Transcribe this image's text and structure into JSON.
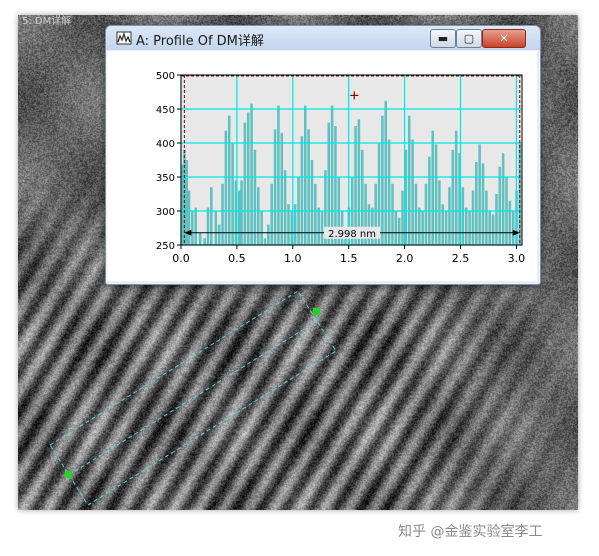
{
  "window": {
    "title": "A: Profile Of DM详解",
    "minimize_glyph": "▬",
    "maximize_glyph": "▢",
    "close_glyph": "✕",
    "app_icon": "profile-tool-icon",
    "behind_title": "5: DM详解"
  },
  "colors": {
    "plot_background": "#e8e8e8",
    "grid": "#00e6e6",
    "bars": "#5fc1c0",
    "marker": "#8b0000",
    "selection_outline": "#58d6e0",
    "handle": "#21d421"
  },
  "chart_data": {
    "type": "bar",
    "x_range": [
      0.0,
      3.05
    ],
    "ylim": [
      250,
      500
    ],
    "x_ticks": [
      "0.0",
      "0.5",
      "1.0",
      "1.5",
      "2.0",
      "2.5",
      "3.0"
    ],
    "y_ticks": [
      "250",
      "300",
      "350",
      "400",
      "450",
      "500"
    ],
    "grid": true,
    "measurement_label": "2.998 nm",
    "measurement_range": [
      0.03,
      3.03
    ],
    "crosshair": [
      1.55,
      470
    ],
    "profile": [
      [
        0.0,
        368
      ],
      [
        0.02,
        390
      ],
      [
        0.04,
        375
      ],
      [
        0.06,
        330
      ],
      [
        0.09,
        300
      ],
      [
        0.12,
        305
      ],
      [
        0.16,
        268
      ],
      [
        0.2,
        260
      ],
      [
        0.23,
        305
      ],
      [
        0.26,
        335
      ],
      [
        0.3,
        300
      ],
      [
        0.33,
        280
      ],
      [
        0.36,
        340
      ],
      [
        0.39,
        418
      ],
      [
        0.42,
        440
      ],
      [
        0.45,
        400
      ],
      [
        0.48,
        345
      ],
      [
        0.51,
        330
      ],
      [
        0.53,
        345
      ],
      [
        0.56,
        430
      ],
      [
        0.59,
        445
      ],
      [
        0.62,
        458
      ],
      [
        0.65,
        390
      ],
      [
        0.68,
        335
      ],
      [
        0.71,
        300
      ],
      [
        0.74,
        260
      ],
      [
        0.77,
        280
      ],
      [
        0.8,
        340
      ],
      [
        0.83,
        420
      ],
      [
        0.86,
        455
      ],
      [
        0.89,
        415
      ],
      [
        0.92,
        360
      ],
      [
        0.95,
        310
      ],
      [
        0.98,
        300
      ],
      [
        1.01,
        310
      ],
      [
        1.04,
        350
      ],
      [
        1.07,
        410
      ],
      [
        1.1,
        455
      ],
      [
        1.13,
        420
      ],
      [
        1.16,
        375
      ],
      [
        1.19,
        340
      ],
      [
        1.22,
        305
      ],
      [
        1.25,
        300
      ],
      [
        1.28,
        360
      ],
      [
        1.31,
        430
      ],
      [
        1.34,
        455
      ],
      [
        1.37,
        425
      ],
      [
        1.4,
        350
      ],
      [
        1.43,
        300
      ],
      [
        1.46,
        270
      ],
      [
        1.49,
        305
      ],
      [
        1.52,
        350
      ],
      [
        1.55,
        425
      ],
      [
        1.58,
        435
      ],
      [
        1.61,
        390
      ],
      [
        1.64,
        340
      ],
      [
        1.67,
        310
      ],
      [
        1.7,
        305
      ],
      [
        1.73,
        340
      ],
      [
        1.76,
        400
      ],
      [
        1.79,
        440
      ],
      [
        1.82,
        462
      ],
      [
        1.85,
        405
      ],
      [
        1.88,
        340
      ],
      [
        1.91,
        300
      ],
      [
        1.94,
        290
      ],
      [
        1.97,
        330
      ],
      [
        2.0,
        390
      ],
      [
        2.03,
        440
      ],
      [
        2.06,
        405
      ],
      [
        2.09,
        340
      ],
      [
        2.12,
        305
      ],
      [
        2.15,
        300
      ],
      [
        2.18,
        340
      ],
      [
        2.21,
        380
      ],
      [
        2.24,
        418
      ],
      [
        2.27,
        398
      ],
      [
        2.3,
        345
      ],
      [
        2.33,
        310
      ],
      [
        2.36,
        300
      ],
      [
        2.39,
        335
      ],
      [
        2.42,
        390
      ],
      [
        2.45,
        418
      ],
      [
        2.48,
        385
      ],
      [
        2.51,
        335
      ],
      [
        2.54,
        305
      ],
      [
        2.57,
        300
      ],
      [
        2.6,
        330
      ],
      [
        2.63,
        372
      ],
      [
        2.66,
        398
      ],
      [
        2.69,
        370
      ],
      [
        2.72,
        330
      ],
      [
        2.75,
        300
      ],
      [
        2.78,
        295
      ],
      [
        2.81,
        325
      ],
      [
        2.84,
        365
      ],
      [
        2.87,
        385
      ],
      [
        2.9,
        350
      ],
      [
        2.93,
        315
      ],
      [
        2.96,
        300
      ],
      [
        2.99,
        330
      ],
      [
        3.02,
        400
      ]
    ]
  },
  "watermark": "知乎 @金鉴实验室李工"
}
